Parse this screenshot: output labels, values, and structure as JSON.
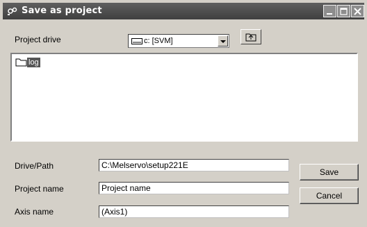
{
  "window": {
    "title": "Save as project",
    "buttons": [
      "minimize-icon",
      "maximize-icon",
      "close-icon"
    ]
  },
  "project_drive": {
    "label": "Project drive",
    "selected": "c: [SVM]",
    "icon": "drive-icon"
  },
  "folders": [
    {
      "name": "log",
      "icon": "folder-icon",
      "selected": true
    }
  ],
  "form": {
    "drive_path": {
      "label": "Drive/Path",
      "value": "C:\\Melservo\\setup221E"
    },
    "project_name": {
      "label": "Project name",
      "value": "Project name"
    },
    "axis_name": {
      "label": "Axis name",
      "value": "(Axis1)"
    }
  },
  "actions": {
    "save": "Save",
    "cancel": "Cancel"
  },
  "colors": {
    "titlebar": "#4f4f4f",
    "face": "#d4d0c8",
    "selection": "#555555"
  }
}
